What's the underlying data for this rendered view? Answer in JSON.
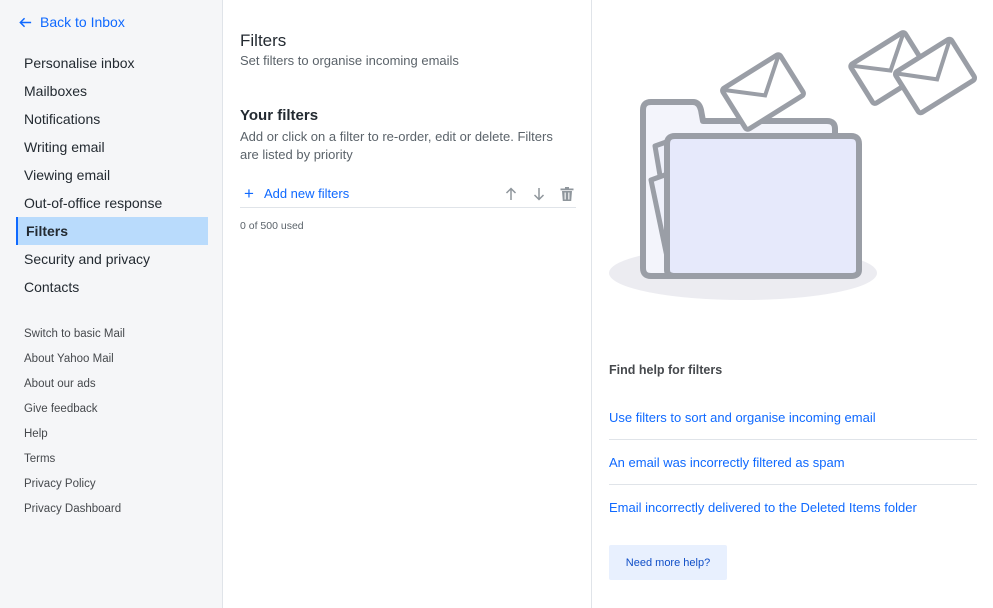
{
  "sidebar": {
    "back_label": "Back to Inbox",
    "items": [
      {
        "label": "Personalise inbox"
      },
      {
        "label": "Mailboxes"
      },
      {
        "label": "Notifications"
      },
      {
        "label": "Writing email"
      },
      {
        "label": "Viewing email"
      },
      {
        "label": "Out-of-office response"
      },
      {
        "label": "Filters",
        "active": true
      },
      {
        "label": "Security and privacy"
      },
      {
        "label": "Contacts"
      }
    ],
    "secondary": [
      {
        "label": "Switch to basic Mail"
      },
      {
        "label": "About Yahoo Mail"
      },
      {
        "label": "About our ads"
      },
      {
        "label": "Give feedback"
      },
      {
        "label": "Help"
      },
      {
        "label": "Terms"
      },
      {
        "label": "Privacy Policy"
      },
      {
        "label": "Privacy Dashboard"
      }
    ]
  },
  "main": {
    "title": "Filters",
    "subtitle": "Set filters to organise incoming emails",
    "section_title": "Your filters",
    "section_desc": "Add or click on a filter to re-order, edit or delete. Filters are listed by priority",
    "add_label": "Add new filters",
    "add_icon": "+",
    "used": "0 of 500 used",
    "tool_icons": [
      "arrow-up-icon",
      "arrow-down-icon",
      "trash-icon"
    ]
  },
  "help": {
    "title": "Find help for filters",
    "links": [
      {
        "label": "Use filters to sort and organise incoming email"
      },
      {
        "label": "An email was incorrectly filtered as spam"
      },
      {
        "label": "Email incorrectly delivered to the Deleted Items folder"
      }
    ],
    "more_label": "Need more help?"
  },
  "colors": {
    "accent": "#0f69ff",
    "active_bg": "#b9dbfc",
    "sidebar_bg": "#f5f6f8",
    "illustration_stroke": "#9a9ea6"
  }
}
